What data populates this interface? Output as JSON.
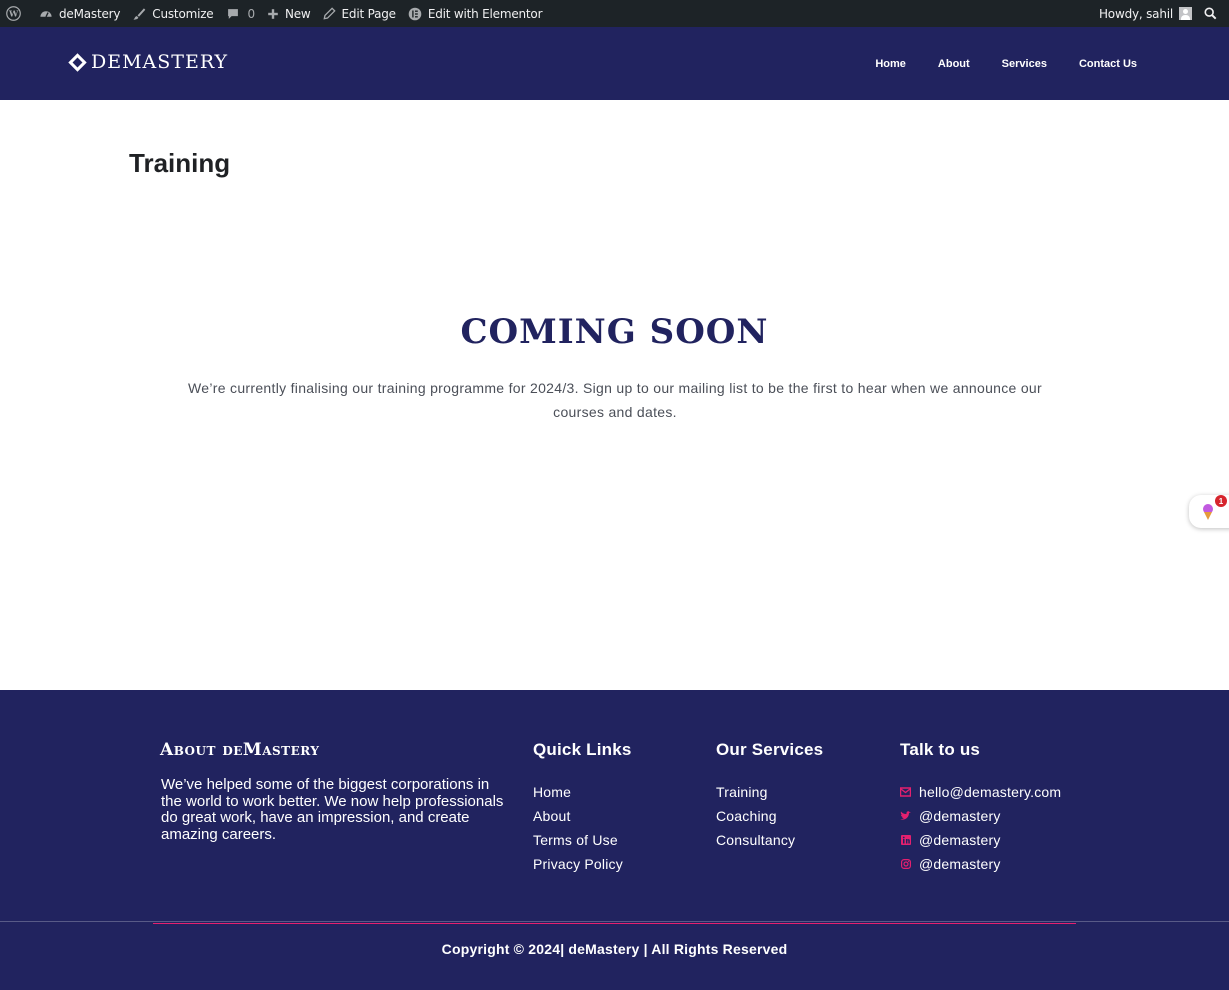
{
  "adminbar": {
    "site": "deMastery",
    "customize": "Customize",
    "comments": "0",
    "new": "New",
    "edit_page": "Edit Page",
    "edit_elementor": "Edit with Elementor",
    "howdy": "Howdy, sahil"
  },
  "header": {
    "logo": "DEMASTERY",
    "nav": [
      "Home",
      "About",
      "Services",
      "Contact Us"
    ]
  },
  "page": {
    "title": "Training",
    "coming_soon": "COMING SOON",
    "text": "We’re currently finalising our training programme for 2024/3. Sign up to our mailing list to be the first to hear when we announce our courses and dates."
  },
  "widget": {
    "badge": "1"
  },
  "footer": {
    "about_title": "About deMastery",
    "about_text": "We’ve helped some of the biggest corporations in the world to work better. We now help professionals do great work, have an impression, and create amazing careers.",
    "quick_links_title": "Quick Links",
    "quick_links": [
      "Home",
      "About",
      "Terms of Use",
      "Privacy Policy"
    ],
    "services_title": "Our Services",
    "services": [
      "Training",
      "Coaching",
      "Consultancy"
    ],
    "talk_title": "Talk to us",
    "contacts": [
      {
        "icon": "email-icon",
        "text": "hello@demastery.com"
      },
      {
        "icon": "twitter-icon",
        "text": "@demastery"
      },
      {
        "icon": "linkedin-icon",
        "text": "@demastery"
      },
      {
        "icon": "instagram-icon",
        "text": "@demastery"
      }
    ],
    "copyright": "Copyright © 2024| deMastery | All Rights Reserved"
  },
  "colors": {
    "brand": "#21235f",
    "accent": "#e4206f",
    "adminbar": "#1d2327"
  }
}
